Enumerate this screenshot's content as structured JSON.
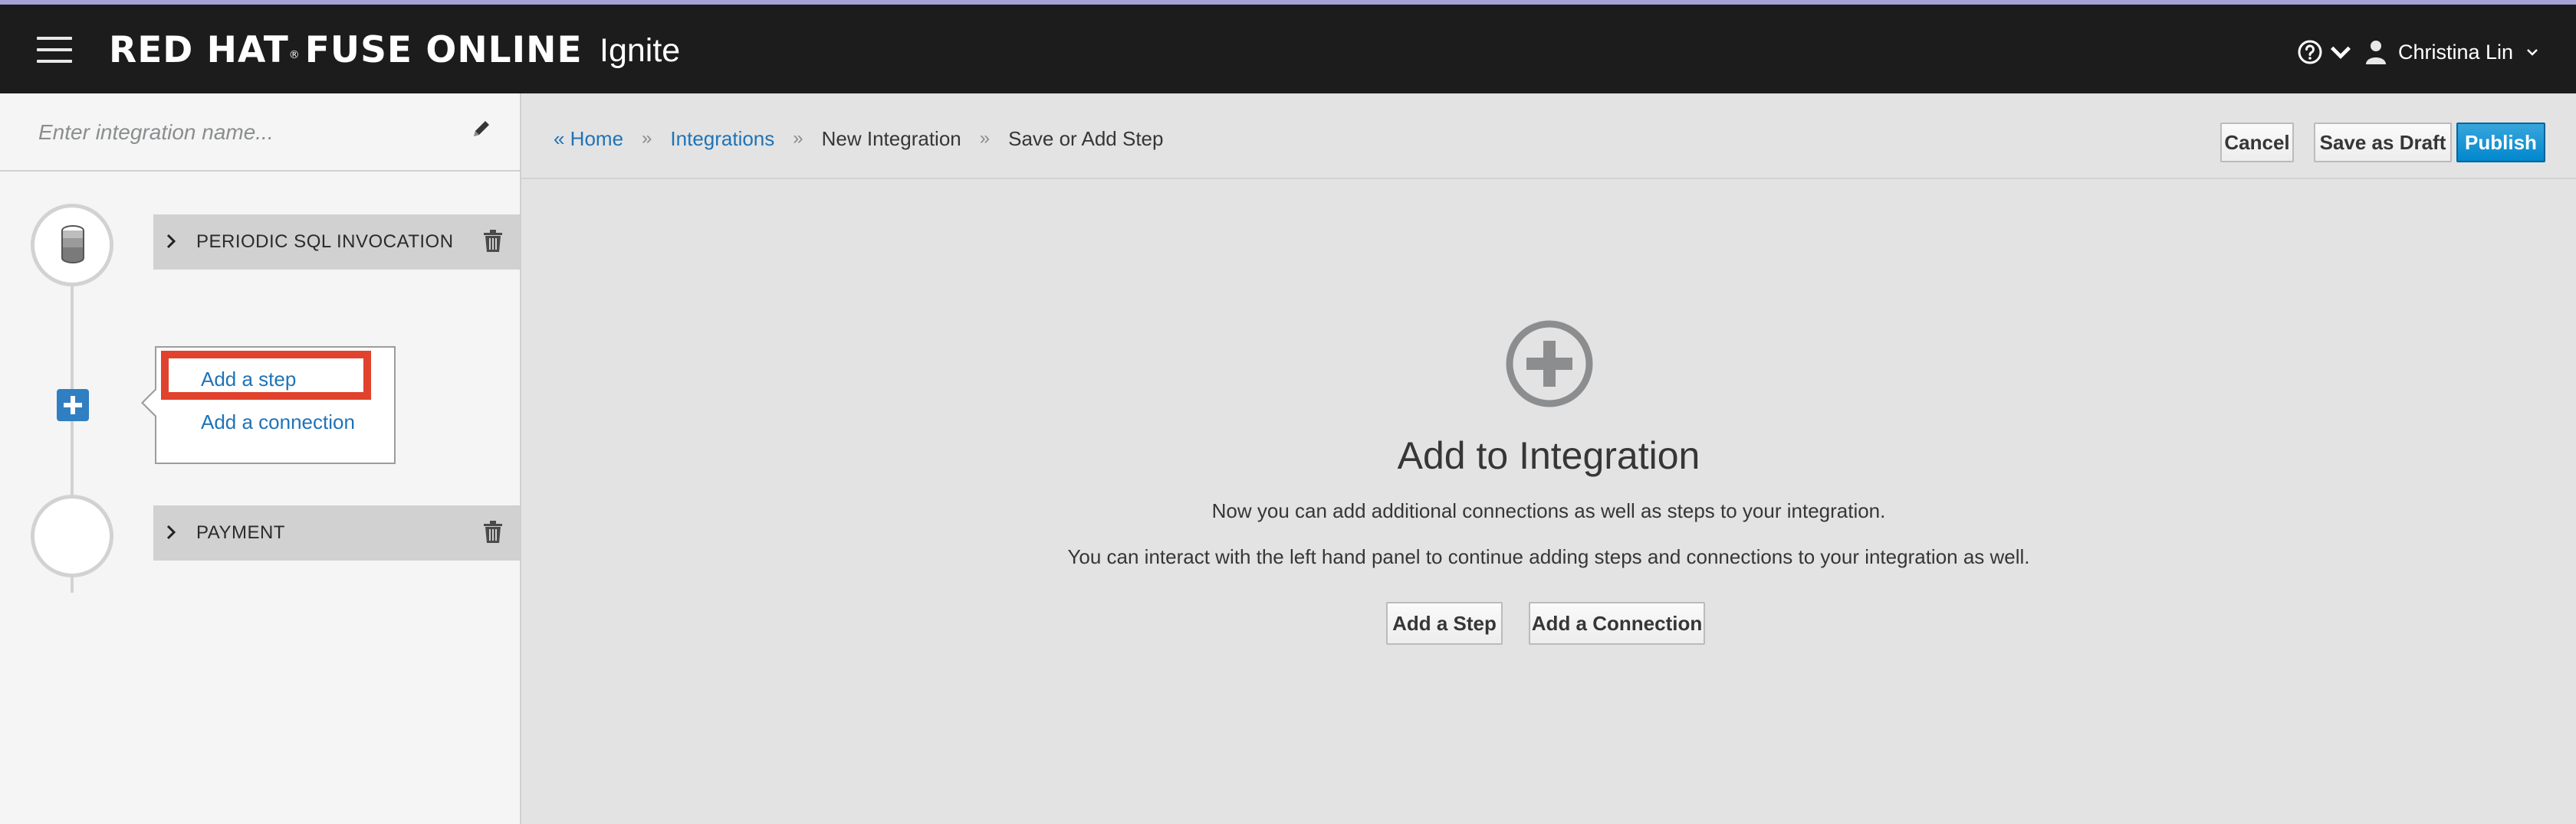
{
  "masthead": {
    "brand": "RED HAT",
    "brand_mark": "®",
    "brand_product": "FUSE ONLINE",
    "app_name": "Ignite",
    "user_name": "Christina Lin",
    "icons": [
      "hamburger-icon",
      "help-icon",
      "user-icon",
      "chevron-down-icon"
    ]
  },
  "editor": {
    "name_placeholder": "Enter integration name...",
    "steps": [
      {
        "label": "PERIODIC SQL INVOCATION",
        "icon": "database-icon"
      },
      {
        "label": "PAYMENT",
        "icon": ""
      }
    ],
    "popover": {
      "add_step": "Add a step",
      "add_connection": "Add a connection"
    }
  },
  "breadcrumb": {
    "home": "« Home",
    "integrations": "Integrations",
    "new_integration": "New Integration",
    "current": "Save or Add Step",
    "separator": "»"
  },
  "toolbar": {
    "cancel": "Cancel",
    "save_draft": "Save as Draft",
    "publish": "Publish"
  },
  "empty_state": {
    "title": "Add to Integration",
    "line1": "Now you can add additional connections as well as steps to your integration.",
    "line2": "You can interact with the left hand panel to continue adding steps and connections to your integration as well.",
    "add_step_button": "Add a Step",
    "add_connection_button": "Add a Connection"
  },
  "colors": {
    "masthead_bg": "#1c1c1c",
    "link": "#1f73b7",
    "primary": "#0088ce",
    "highlight": "#e0422d",
    "plus_button": "#2f7fc2"
  }
}
